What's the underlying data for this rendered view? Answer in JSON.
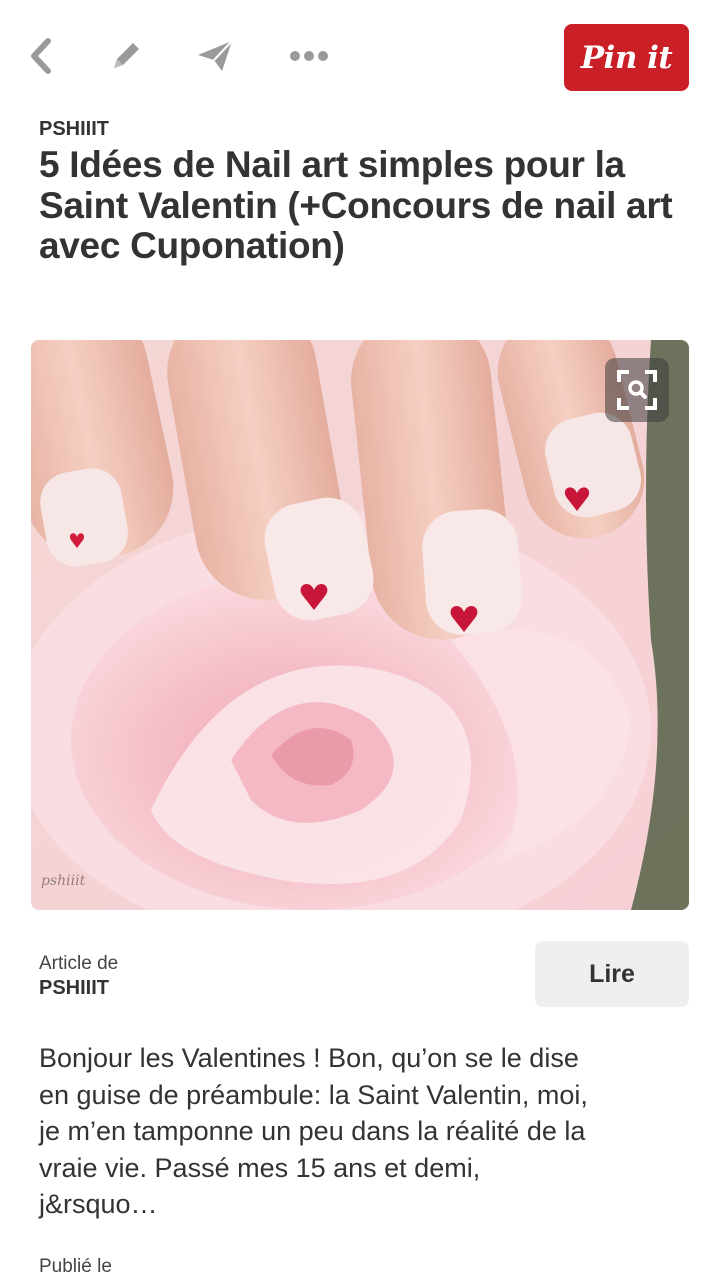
{
  "toolbar": {
    "icons": [
      "back-chevron-icon",
      "edit-pencil-icon",
      "send-icon",
      "more-dots-icon"
    ],
    "pin_label": "Pin it",
    "pin_color": "#cb1f27",
    "icon_color": "#9a9a9a"
  },
  "pin": {
    "source": "PSHIIIT",
    "title": "5 Idées de Nail art simples pour la Saint Valentin (+Concours de nail art avec Cuponation)",
    "image_icon": "visual-search-icon"
  },
  "article": {
    "label": "Article de",
    "source": "PSHIIIT",
    "read_button": "Lire",
    "description": "Bonjour les Valentines ! Bon, qu’on se le dise en guise de préambule: la Saint Valentin, moi, je m’en tamponne un peu dans la réalité de la vraie vie. Passé mes 15 ans et demi, j&rsquo…",
    "published_label": "Publié le"
  }
}
